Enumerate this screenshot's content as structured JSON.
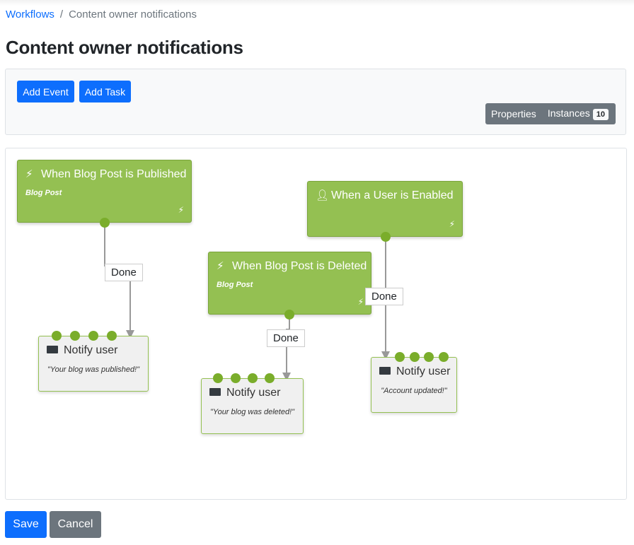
{
  "breadcrumb": {
    "root": "Workflows",
    "separator": "/",
    "current": "Content owner notifications"
  },
  "page_title": "Content owner notifications",
  "toolbar": {
    "add_event": "Add Event",
    "add_task": "Add Task",
    "properties": "Properties",
    "instances": "Instances",
    "instances_count": "10"
  },
  "events": [
    {
      "title": "When Blog Post is Published",
      "subtitle": "Blog Post",
      "icon": "bolt-icon"
    },
    {
      "title": "When a User is Enabled",
      "subtitle": "",
      "icon": "user-check-icon"
    },
    {
      "title": "When Blog Post is Deleted",
      "subtitle": "Blog Post",
      "icon": "bolt-icon"
    }
  ],
  "tasks": [
    {
      "title": "Notify user",
      "message": "\"Your blog was published!\"",
      "icon": "envelope-icon"
    },
    {
      "title": "Notify user",
      "message": "\"Your blog was deleted!\"",
      "icon": "envelope-icon"
    },
    {
      "title": "Notify user",
      "message": "\"Account updated!\"",
      "icon": "envelope-icon"
    }
  ],
  "connections": [
    {
      "label": "Done"
    },
    {
      "label": "Done"
    },
    {
      "label": "Done"
    }
  ],
  "footer": {
    "save": "Save",
    "cancel": "Cancel"
  },
  "colors": {
    "event": "#94c052",
    "endpoint": "#7aad2b",
    "primary": "#0d6efd",
    "secondary": "#6c757d"
  }
}
